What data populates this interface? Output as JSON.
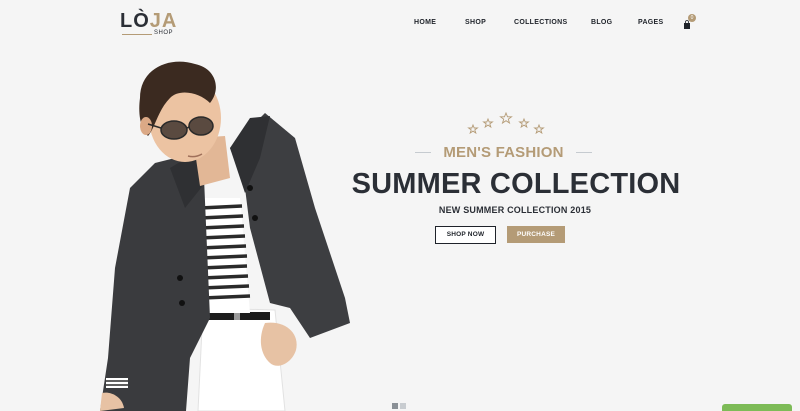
{
  "brand": {
    "logo_prefix": "LÒ",
    "logo_accent": "JA",
    "logo_sub": "SHOP"
  },
  "nav": {
    "items": [
      {
        "label": "HOME"
      },
      {
        "label": "SHOP"
      },
      {
        "label": "COLLECTIONS"
      },
      {
        "label": "BLOG"
      },
      {
        "label": "PAGES"
      }
    ],
    "cart_count": "0"
  },
  "hero": {
    "subtitle": "MEN'S FASHION",
    "headline": "SUMMER COLLECTION",
    "tagline": "NEW SUMMER COLLECTION 2015",
    "shop_now_label": "SHOP NOW",
    "purchase_label": "PURCHASE"
  },
  "slider": {
    "total_slides": 2,
    "active_slide": 1
  },
  "colors": {
    "accent": "#b49b76",
    "dark": "#2b2f36",
    "background": "#f5f5f5",
    "dot_active": "#8a9096",
    "dot_inactive": "#c8ccd0",
    "corner_tab": "#7dbb57"
  },
  "icons": {
    "cart": "shopping-bag-icon",
    "stars": "star-icon"
  }
}
